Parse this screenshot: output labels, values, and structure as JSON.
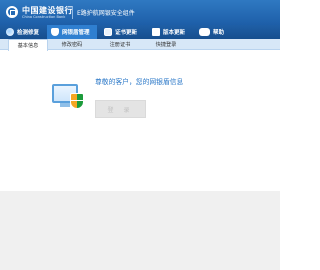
{
  "header": {
    "logo_cn": "中国建设银行",
    "logo_en": "China Construction Bank",
    "app_title": "E路护航网银安全组件"
  },
  "nav": {
    "items": [
      {
        "label": "检测修复",
        "icon": "globe-icon"
      },
      {
        "label": "网银盾管理",
        "icon": "shield-icon"
      },
      {
        "label": "证书更新",
        "icon": "certificate-icon"
      },
      {
        "label": "版本更新",
        "icon": "update-icon"
      },
      {
        "label": "帮助",
        "icon": "help-icon"
      }
    ],
    "active_index": 1
  },
  "subnav": {
    "tabs": [
      "基本信息",
      "修改密码",
      "注册证书",
      "快捷登录"
    ],
    "active_index": 0
  },
  "main": {
    "greeting": "尊敬的客户，您的网银盾信息",
    "login_button": "登 录"
  },
  "colors": {
    "header_blue": "#1d5ea8",
    "accent_blue": "#2b78c8",
    "subnav_bg": "#d7e7f7"
  }
}
